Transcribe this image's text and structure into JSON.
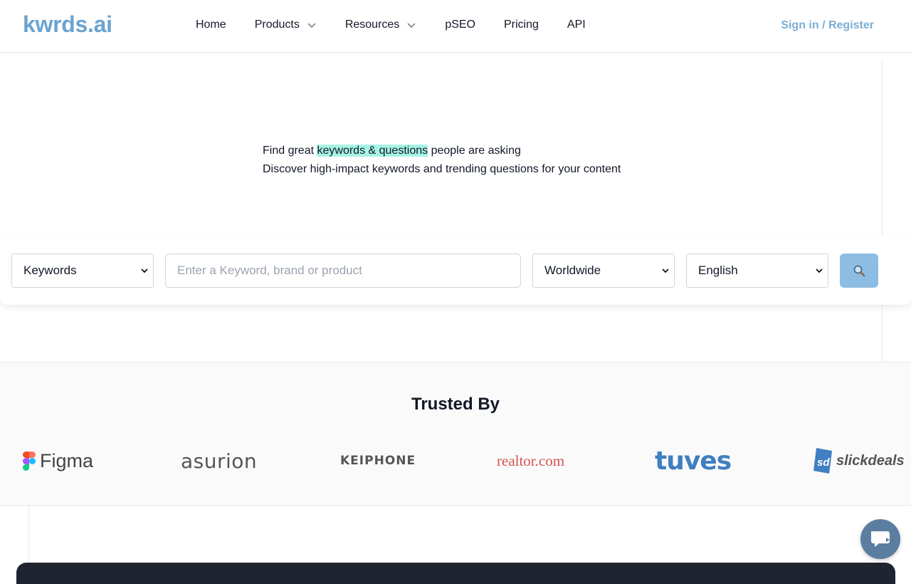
{
  "header": {
    "logo": "kwrds.ai",
    "nav": [
      {
        "label": "Home",
        "has_dropdown": false
      },
      {
        "label": "Products",
        "has_dropdown": true
      },
      {
        "label": "Resources",
        "has_dropdown": true
      },
      {
        "label": "pSEO",
        "has_dropdown": false
      },
      {
        "label": "Pricing",
        "has_dropdown": false
      },
      {
        "label": "API",
        "has_dropdown": false
      }
    ],
    "signin": "Sign in / Register"
  },
  "hero": {
    "title_prefix": "Find great ",
    "title_highlight": "keywords & questions",
    "title_suffix": " people are asking",
    "subtitle": "Discover high-impact keywords and trending questions for your content"
  },
  "search": {
    "mode_selected": "Keywords",
    "placeholder": "Enter a Keyword, brand or product",
    "location_selected": "Worldwide",
    "language_selected": "English",
    "button_icon": "search-icon"
  },
  "trusted": {
    "title": "Trusted By",
    "logos": [
      "Figma",
      "asurion",
      "KEIPHONE",
      "realtor.com",
      "tuves",
      "slickdeals"
    ]
  },
  "colors": {
    "brand": "#6ba3cf",
    "highlight": "#a7f3e6",
    "search_button": "#8dbde3",
    "chat_button": "#5b7ea0"
  }
}
